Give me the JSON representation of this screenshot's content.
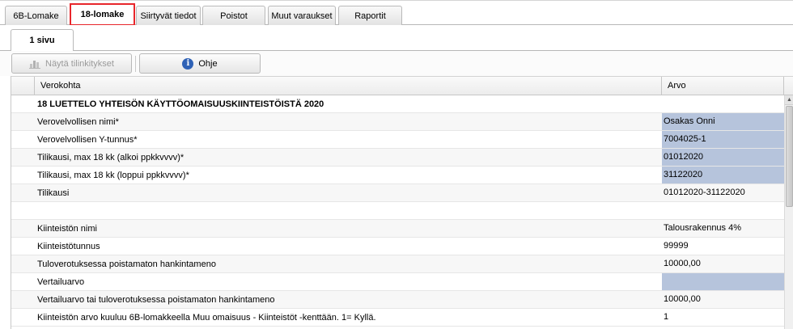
{
  "top_tabs": [
    {
      "label": "6B-Lomake"
    },
    {
      "label": "18-lomake"
    },
    {
      "label": "Siirtyvät tiedot"
    },
    {
      "label": "Poistot"
    },
    {
      "label": "Muut varaukset"
    },
    {
      "label": "Raportit"
    }
  ],
  "sub_tabs": [
    {
      "label": "1 sivu"
    }
  ],
  "toolbar": {
    "show_accounts_label": "Näytä tilinkitykset",
    "help_label": "Ohje"
  },
  "grid": {
    "columns": [
      "Verokohta",
      "Arvo"
    ],
    "rows": [
      {
        "label": "18 LUETTELO YHTEISÖN KÄYTTÖOMAISUUSKIINTEISTÖISTÄ 2020",
        "value": ""
      },
      {
        "label": "Verovelvollisen nimi*",
        "value": "Osakas Onni"
      },
      {
        "label": "Verovelvollisen Y-tunnus*",
        "value": "7004025-1"
      },
      {
        "label": "Tilikausi, max 18 kk (alkoi ppkkvvvv)*",
        "value": "01012020"
      },
      {
        "label": "Tilikausi, max 18 kk (loppui ppkkvvvv)*",
        "value": "31122020"
      },
      {
        "label": "Tilikausi",
        "value": "01012020-31122020"
      },
      {
        "label": "",
        "value": ""
      },
      {
        "label": "Kiinteistön nimi",
        "value": "Talousrakennus 4%"
      },
      {
        "label": "Kiinteistötunnus",
        "value": "99999"
      },
      {
        "label": "Tuloverotuksessa poistamaton hankintameno",
        "value": "10000,00"
      },
      {
        "label": "Vertailuarvo",
        "value": ""
      },
      {
        "label": "Vertailuarvo tai tuloverotuksessa poistamaton hankintameno",
        "value": "10000,00"
      },
      {
        "label": "Kiinteistön arvo kuuluu 6B-lomakkeella Muu omaisuus - Kiinteistöt -kenttään. 1= Kyllä.",
        "value": "1"
      }
    ]
  },
  "colors": {
    "active_tab_border": "#e8262b",
    "editable_cell": "#b6c4dc",
    "info_icon": "#2f62b6"
  }
}
